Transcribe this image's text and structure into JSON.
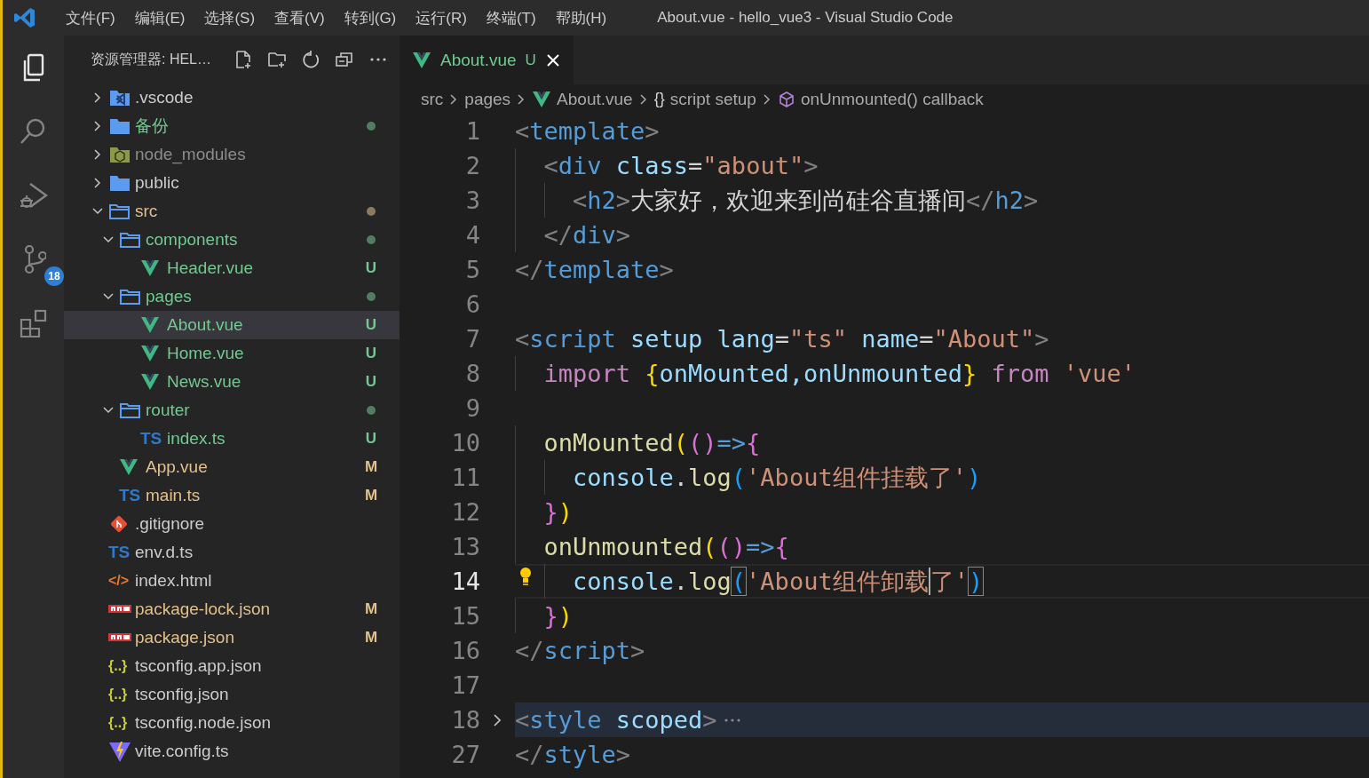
{
  "title_bar": {
    "menu": [
      "文件(F)",
      "编辑(E)",
      "选择(S)",
      "查看(V)",
      "转到(G)",
      "运行(R)",
      "终端(T)",
      "帮助(H)"
    ],
    "title": "About.vue - hello_vue3 - Visual Studio Code"
  },
  "activity_bar": [
    {
      "kind": "explorer",
      "selected": true
    },
    {
      "kind": "search",
      "selected": false
    },
    {
      "kind": "debug",
      "selected": false
    },
    {
      "kind": "scm",
      "selected": false,
      "badge": "18"
    },
    {
      "kind": "extensions",
      "selected": false
    }
  ],
  "explorer": {
    "title": "资源管理器: HEL…",
    "tree": [
      {
        "name": ".vscode",
        "kind": "vscode-folder",
        "expanded": false,
        "selected": false,
        "color": "#cccccc"
      },
      {
        "name": "备份",
        "kind": "folder",
        "expanded": false,
        "selected": false,
        "color": "#73c991",
        "has_changes": true
      },
      {
        "name": "node_modules",
        "kind": "node-folder",
        "expanded": false,
        "selected": false,
        "color": "#8c8c8c"
      },
      {
        "name": "public",
        "kind": "folder",
        "expanded": false,
        "selected": false,
        "color": "#cccccc"
      },
      {
        "name": "src",
        "kind": "folder",
        "expanded": true,
        "selected": false,
        "color": "#e2c08d",
        "has_changes": true,
        "children": [
          {
            "name": "components",
            "kind": "folder",
            "expanded": true,
            "selected": false,
            "color": "#73c991",
            "has_changes": true,
            "children": [
              {
                "name": "Header.vue",
                "kind": "vue",
                "selected": false,
                "color": "#73c991",
                "badge": "U"
              }
            ]
          },
          {
            "name": "pages",
            "kind": "folder",
            "expanded": true,
            "selected": false,
            "color": "#73c991",
            "has_changes": true,
            "children": [
              {
                "name": "About.vue",
                "kind": "vue",
                "selected": true,
                "color": "#73c991",
                "badge": "U"
              },
              {
                "name": "Home.vue",
                "kind": "vue",
                "selected": false,
                "color": "#73c991",
                "badge": "U"
              },
              {
                "name": "News.vue",
                "kind": "vue",
                "selected": false,
                "color": "#73c991",
                "badge": "U"
              }
            ]
          },
          {
            "name": "router",
            "kind": "folder",
            "expanded": true,
            "selected": false,
            "color": "#73c991",
            "has_changes": true,
            "children": [
              {
                "name": "index.ts",
                "kind": "ts",
                "glyph": "TS",
                "selected": false,
                "color": "#73c991",
                "badge": "U"
              }
            ]
          },
          {
            "name": "App.vue",
            "kind": "vue",
            "selected": false,
            "color": "#e2c08d",
            "badge": "M"
          },
          {
            "name": "main.ts",
            "kind": "ts",
            "glyph": "TS",
            "selected": false,
            "color": "#e2c08d",
            "badge": "M"
          }
        ]
      },
      {
        "name": ".gitignore",
        "kind": "git",
        "selected": false,
        "color": "#cccccc"
      },
      {
        "name": "env.d.ts",
        "kind": "ts",
        "glyph": "TS",
        "selected": false,
        "color": "#cccccc"
      },
      {
        "name": "index.html",
        "kind": "html",
        "glyph": "</>",
        "selected": false,
        "color": "#cccccc"
      },
      {
        "name": "package-lock.json",
        "kind": "npm",
        "selected": false,
        "color": "#e2c08d",
        "badge": "M"
      },
      {
        "name": "package.json",
        "kind": "npm",
        "selected": false,
        "color": "#e2c08d",
        "badge": "M"
      },
      {
        "name": "tsconfig.app.json",
        "kind": "json",
        "glyph": "{..}",
        "selected": false,
        "color": "#cccccc"
      },
      {
        "name": "tsconfig.json",
        "kind": "json",
        "glyph": "{..}",
        "selected": false,
        "color": "#cccccc"
      },
      {
        "name": "tsconfig.node.json",
        "kind": "json",
        "glyph": "{..}",
        "selected": false,
        "color": "#cccccc"
      },
      {
        "name": "vite.config.ts",
        "kind": "vite",
        "selected": false,
        "color": "#cccccc"
      }
    ]
  },
  "tabs": [
    {
      "label": "About.vue",
      "kind": "vue",
      "badge": "U",
      "selected": true
    }
  ],
  "breadcrumbs": [
    {
      "label": "src"
    },
    {
      "label": "pages"
    },
    {
      "label": "About.vue",
      "kind": "vue"
    },
    {
      "label": "script setup",
      "glyph": "{}"
    },
    {
      "label": "onUnmounted() callback",
      "kind": "cube"
    }
  ],
  "lines": [
    {
      "number": "1",
      "tokens": [
        {
          "text": "<",
          "kind": "punct"
        },
        {
          "text": "template",
          "kind": "tag"
        },
        {
          "text": ">",
          "kind": "punct"
        }
      ]
    },
    {
      "number": "2",
      "tokens": [
        {
          "text": "  <",
          "kind": "punct"
        },
        {
          "text": "div",
          "kind": "tag"
        },
        {
          "text": " class",
          "kind": "attr"
        },
        {
          "text": "=",
          "kind": "op"
        },
        {
          "text": "\"about\"",
          "kind": "string"
        },
        {
          "text": ">",
          "kind": "punct"
        }
      ]
    },
    {
      "number": "3",
      "tokens": [
        {
          "text": "    <",
          "kind": "punct"
        },
        {
          "text": "h2",
          "kind": "tag"
        },
        {
          "text": ">",
          "kind": "punct"
        },
        {
          "text": "大家好，欢迎来到尚硅谷直播间",
          "kind": "text"
        },
        {
          "text": "</",
          "kind": "punct"
        },
        {
          "text": "h2",
          "kind": "tag"
        },
        {
          "text": ">",
          "kind": "punct"
        }
      ]
    },
    {
      "number": "4",
      "tokens": [
        {
          "text": "  </",
          "kind": "punct"
        },
        {
          "text": "div",
          "kind": "tag"
        },
        {
          "text": ">",
          "kind": "punct"
        }
      ]
    },
    {
      "number": "5",
      "tokens": [
        {
          "text": "</",
          "kind": "punct"
        },
        {
          "text": "template",
          "kind": "tag"
        },
        {
          "text": ">",
          "kind": "punct"
        }
      ]
    },
    {
      "number": "6"
    },
    {
      "number": "7",
      "tokens": [
        {
          "text": "<",
          "kind": "punct"
        },
        {
          "text": "script",
          "kind": "tag"
        },
        {
          "text": " setup",
          "kind": "attr"
        },
        {
          "text": " lang",
          "kind": "attr"
        },
        {
          "text": "=",
          "kind": "op"
        },
        {
          "text": "\"ts\"",
          "kind": "string"
        },
        {
          "text": " name",
          "kind": "attr"
        },
        {
          "text": "=",
          "kind": "op"
        },
        {
          "text": "\"About\"",
          "kind": "string"
        },
        {
          "text": ">",
          "kind": "punct"
        }
      ]
    },
    {
      "number": "8",
      "tokens": [
        {
          "text": "  import",
          "kind": "keyword"
        },
        {
          "text": " {",
          "kind": "bracket1"
        },
        {
          "text": "onMounted,onUnmounted",
          "kind": "var"
        },
        {
          "text": "}",
          "kind": "bracket1"
        },
        {
          "text": " from",
          "kind": "keyword"
        },
        {
          "text": " 'vue'",
          "kind": "string"
        }
      ]
    },
    {
      "number": "9"
    },
    {
      "number": "10",
      "tokens": [
        {
          "text": "  onMounted",
          "kind": "func"
        },
        {
          "text": "(",
          "kind": "bracket1"
        },
        {
          "text": "()",
          "kind": "bracket2"
        },
        {
          "text": "=>",
          "kind": "arrow"
        },
        {
          "text": "{",
          "kind": "bracket2"
        }
      ]
    },
    {
      "number": "11",
      "tokens": [
        {
          "text": "    console",
          "kind": "var"
        },
        {
          "text": ".",
          "kind": "op"
        },
        {
          "text": "log",
          "kind": "func"
        },
        {
          "text": "(",
          "kind": "bracket3"
        },
        {
          "text": "'About组件挂载了'",
          "kind": "string"
        },
        {
          "text": ")",
          "kind": "bracket3"
        }
      ]
    },
    {
      "number": "12",
      "tokens": [
        {
          "text": "  }",
          "kind": "bracket2"
        },
        {
          "text": ")",
          "kind": "bracket1"
        }
      ]
    },
    {
      "number": "13",
      "tokens": [
        {
          "text": "  onUnmounted",
          "kind": "func"
        },
        {
          "text": "(",
          "kind": "bracket1"
        },
        {
          "text": "()",
          "kind": "bracket2"
        },
        {
          "text": "=>",
          "kind": "arrow"
        },
        {
          "text": "{",
          "kind": "bracket2"
        }
      ]
    },
    {
      "number": "14",
      "current": true,
      "lightbulb": true,
      "tokens": [
        {
          "text": "    console",
          "kind": "var"
        },
        {
          "text": ".",
          "kind": "op"
        },
        {
          "text": "log",
          "kind": "func"
        },
        {
          "text": "(",
          "kind": "bracket3",
          "matched": true
        },
        {
          "text": "'About组件卸载",
          "kind": "string"
        },
        {
          "text": "了'",
          "kind": "string",
          "cursor": true
        },
        {
          "text": ")",
          "kind": "bracket3",
          "matched": true
        }
      ]
    },
    {
      "number": "15",
      "tokens": [
        {
          "text": "  }",
          "kind": "bracket2"
        },
        {
          "text": ")",
          "kind": "bracket1"
        }
      ]
    },
    {
      "number": "16",
      "tokens": [
        {
          "text": "</",
          "kind": "punct"
        },
        {
          "text": "script",
          "kind": "tag"
        },
        {
          "text": ">",
          "kind": "punct"
        }
      ]
    },
    {
      "number": "17"
    },
    {
      "number": "18",
      "folded": true,
      "tokens": [
        {
          "text": "<",
          "kind": "punct"
        },
        {
          "text": "style",
          "kind": "tag"
        },
        {
          "text": " scoped",
          "kind": "attr"
        },
        {
          "text": ">",
          "kind": "punct"
        }
      ]
    },
    {
      "number": "27",
      "tokens": [
        {
          "text": "</",
          "kind": "punct"
        },
        {
          "text": "style",
          "kind": "tag"
        },
        {
          "text": ">",
          "kind": "punct"
        }
      ]
    }
  ]
}
